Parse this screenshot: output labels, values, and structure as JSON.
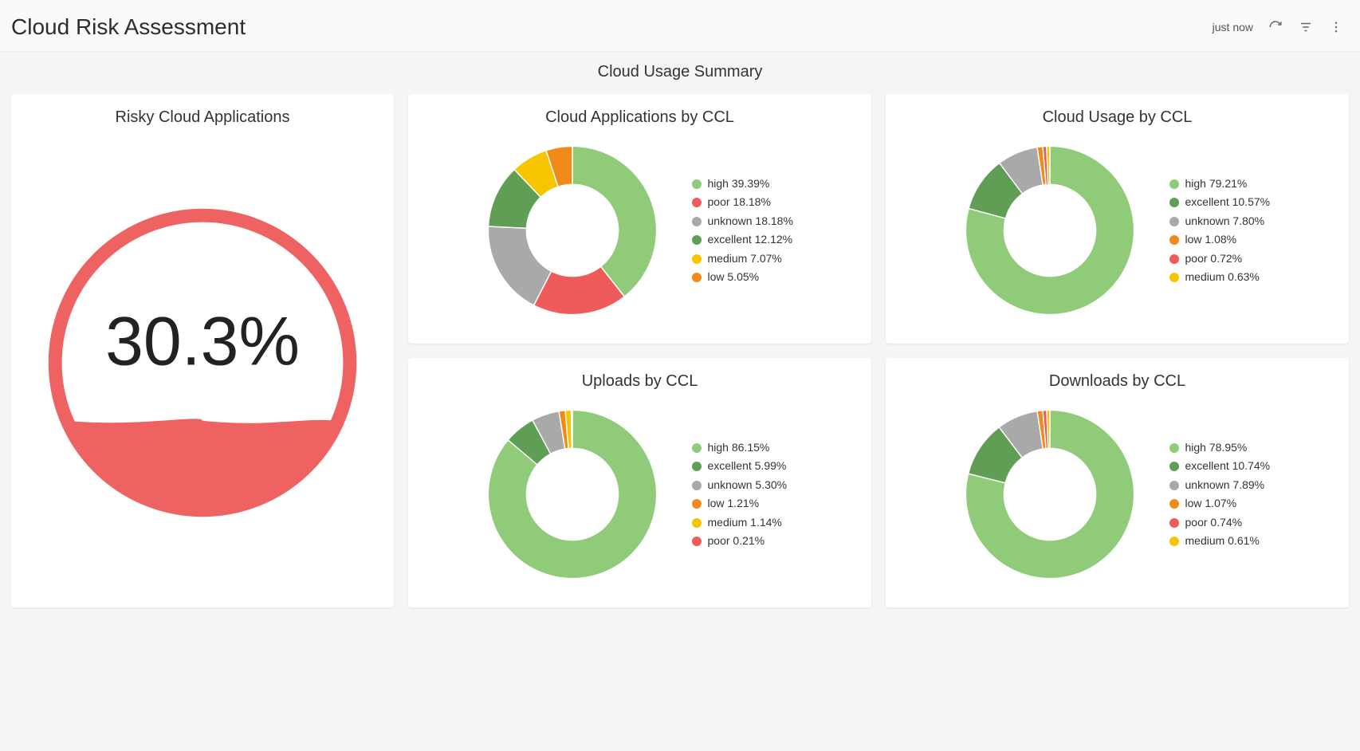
{
  "header": {
    "title": "Cloud Risk Assessment",
    "timestamp": "just now"
  },
  "subtitle": "Cloud Usage Summary",
  "colors": {
    "high": "#8fcb79",
    "poor": "#ef5b5b",
    "unknown": "#a9a9a9",
    "excellent": "#5f9e54",
    "medium": "#f6c500",
    "low": "#f08a1b",
    "gauge": "#ee6262"
  },
  "gauge": {
    "title": "Risky Cloud Applications",
    "value": 30.3,
    "display": "30.3%"
  },
  "charts": {
    "apps": {
      "title": "Cloud Applications by CCL",
      "series": [
        {
          "name": "high",
          "label": "high 39.39%",
          "value": 39.39,
          "colorKey": "high"
        },
        {
          "name": "poor",
          "label": "poor 18.18%",
          "value": 18.18,
          "colorKey": "poor"
        },
        {
          "name": "unknown",
          "label": "unknown 18.18%",
          "value": 18.18,
          "colorKey": "unknown"
        },
        {
          "name": "excellent",
          "label": "excellent 12.12%",
          "value": 12.12,
          "colorKey": "excellent"
        },
        {
          "name": "medium",
          "label": "medium 7.07%",
          "value": 7.07,
          "colorKey": "medium"
        },
        {
          "name": "low",
          "label": "low 5.05%",
          "value": 5.05,
          "colorKey": "low"
        }
      ]
    },
    "usage": {
      "title": "Cloud Usage by CCL",
      "series": [
        {
          "name": "high",
          "label": "high 79.21%",
          "value": 79.21,
          "colorKey": "high"
        },
        {
          "name": "excellent",
          "label": "excellent 10.57%",
          "value": 10.57,
          "colorKey": "excellent"
        },
        {
          "name": "unknown",
          "label": "unknown 7.80%",
          "value": 7.8,
          "colorKey": "unknown"
        },
        {
          "name": "low",
          "label": "low 1.08%",
          "value": 1.08,
          "colorKey": "low"
        },
        {
          "name": "poor",
          "label": "poor 0.72%",
          "value": 0.72,
          "colorKey": "poor"
        },
        {
          "name": "medium",
          "label": "medium 0.63%",
          "value": 0.63,
          "colorKey": "medium"
        }
      ]
    },
    "uploads": {
      "title": "Uploads by CCL",
      "series": [
        {
          "name": "high",
          "label": "high 86.15%",
          "value": 86.15,
          "colorKey": "high"
        },
        {
          "name": "excellent",
          "label": "excellent 5.99%",
          "value": 5.99,
          "colorKey": "excellent"
        },
        {
          "name": "unknown",
          "label": "unknown 5.30%",
          "value": 5.3,
          "colorKey": "unknown"
        },
        {
          "name": "low",
          "label": "low 1.21%",
          "value": 1.21,
          "colorKey": "low"
        },
        {
          "name": "medium",
          "label": "medium 1.14%",
          "value": 1.14,
          "colorKey": "medium"
        },
        {
          "name": "poor",
          "label": "poor 0.21%",
          "value": 0.21,
          "colorKey": "poor"
        }
      ]
    },
    "downloads": {
      "title": "Downloads by CCL",
      "series": [
        {
          "name": "high",
          "label": "high 78.95%",
          "value": 78.95,
          "colorKey": "high"
        },
        {
          "name": "excellent",
          "label": "excellent 10.74%",
          "value": 10.74,
          "colorKey": "excellent"
        },
        {
          "name": "unknown",
          "label": "unknown 7.89%",
          "value": 7.89,
          "colorKey": "unknown"
        },
        {
          "name": "low",
          "label": "low 1.07%",
          "value": 1.07,
          "colorKey": "low"
        },
        {
          "name": "poor",
          "label": "poor 0.74%",
          "value": 0.74,
          "colorKey": "poor"
        },
        {
          "name": "medium",
          "label": "medium 0.61%",
          "value": 0.61,
          "colorKey": "medium"
        }
      ]
    }
  },
  "chart_data": [
    {
      "type": "gauge",
      "title": "Risky Cloud Applications",
      "value": 30.3,
      "min": 0,
      "max": 100,
      "unit": "%"
    },
    {
      "type": "pie",
      "title": "Cloud Applications by CCL",
      "categories": [
        "high",
        "poor",
        "unknown",
        "excellent",
        "medium",
        "low"
      ],
      "values": [
        39.39,
        18.18,
        18.18,
        12.12,
        7.07,
        5.05
      ],
      "unit": "%"
    },
    {
      "type": "pie",
      "title": "Cloud Usage by CCL",
      "categories": [
        "high",
        "excellent",
        "unknown",
        "low",
        "poor",
        "medium"
      ],
      "values": [
        79.21,
        10.57,
        7.8,
        1.08,
        0.72,
        0.63
      ],
      "unit": "%"
    },
    {
      "type": "pie",
      "title": "Uploads by CCL",
      "categories": [
        "high",
        "excellent",
        "unknown",
        "low",
        "medium",
        "poor"
      ],
      "values": [
        86.15,
        5.99,
        5.3,
        1.21,
        1.14,
        0.21
      ],
      "unit": "%"
    },
    {
      "type": "pie",
      "title": "Downloads by CCL",
      "categories": [
        "high",
        "excellent",
        "unknown",
        "low",
        "poor",
        "medium"
      ],
      "values": [
        78.95,
        10.74,
        7.89,
        1.07,
        0.74,
        0.61
      ],
      "unit": "%"
    }
  ]
}
